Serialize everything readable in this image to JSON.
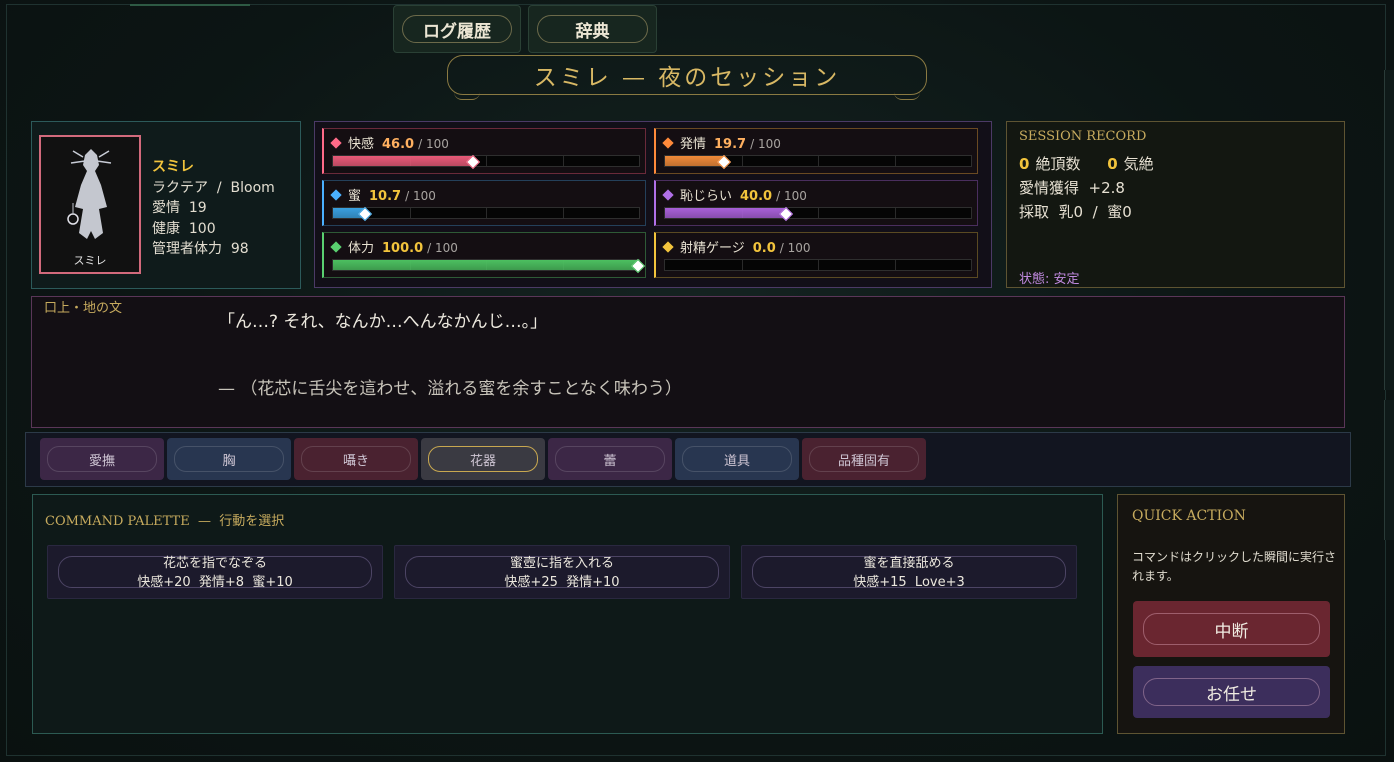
{
  "top_buttons": {
    "log": "ログ履歴",
    "dict": "辞典"
  },
  "title": "スミレ — 夜のセッション",
  "character": {
    "portrait_label": "スミレ",
    "name": "スミレ",
    "species_line": "ラクテア  /  Bloom",
    "affection": "愛情  19",
    "health": "健康  100",
    "manager_stamina": "管理者体力  98"
  },
  "stats": [
    {
      "label": "快感",
      "value": "46.0",
      "max": "/ 100",
      "fraction": 0.46,
      "color": "#e85a78",
      "diamond": "#ff6a88",
      "val_color": "#ffb060"
    },
    {
      "label": "発情",
      "value": "19.7",
      "max": "/ 100",
      "fraction": 0.197,
      "color": "#f08a3a",
      "diamond": "#ff8a3a",
      "val_color": "#ffb060"
    },
    {
      "label": "蜜",
      "value": "10.7",
      "max": "/ 100",
      "fraction": 0.107,
      "color": "#3aa0e0",
      "diamond": "#4ab0ff",
      "val_color": "#f2c43c"
    },
    {
      "label": "恥じらい",
      "value": "40.0",
      "max": "/ 100",
      "fraction": 0.4,
      "color": "#a860d8",
      "diamond": "#b070e8",
      "val_color": "#f2c43c"
    },
    {
      "label": "体力",
      "value": "100.0",
      "max": "/ 100",
      "fraction": 1.0,
      "color": "#4cc060",
      "diamond": "#5ad070",
      "val_color": "#f2c43c"
    },
    {
      "label": "射精ゲージ",
      "value": "0.0",
      "max": "/ 100",
      "fraction": 0.0,
      "color": "#e0b040",
      "diamond": "#f2c43c",
      "val_color": "#f2c43c"
    }
  ],
  "session": {
    "header": "SESSION RECORD",
    "climax_count": "0",
    "climax_label": "絶頂数",
    "faint_count": "0",
    "faint_label": "気絶",
    "affection_gain": "愛情獲得  +2.8",
    "harvest": "採取  乳0  /  蜜0",
    "state": "状態: 安定"
  },
  "dialogue": {
    "tag": "口上・地の文",
    "line1": "「ん…? それ、なんか…へんなかんじ…。」",
    "line2": "— （花芯に舌尖を這わせ、溢れる蜜を余すことなく味わう）"
  },
  "tabs": [
    {
      "label": "愛撫",
      "bg": "#3c2746",
      "active": false
    },
    {
      "label": "胸",
      "bg": "#283650",
      "active": false
    },
    {
      "label": "囁き",
      "bg": "#4a2230",
      "active": false
    },
    {
      "label": "花器",
      "bg": "#3a3a42",
      "active": true
    },
    {
      "label": "蕾",
      "bg": "#3c2746",
      "active": false
    },
    {
      "label": "道具",
      "bg": "#283650",
      "active": false
    },
    {
      "label": "品種固有",
      "bg": "#4a2230",
      "active": false
    }
  ],
  "palette": {
    "header": "COMMAND PALETTE  —  行動を選択",
    "commands": [
      {
        "name": "花芯を指でなぞる",
        "effect": "快感+20  発情+8  蜜+10"
      },
      {
        "name": "蜜壺に指を入れる",
        "effect": "快感+25  発情+10"
      },
      {
        "name": "蜜を直接舐める",
        "effect": "快感+15  Love+3"
      }
    ]
  },
  "quick": {
    "header": "QUICK ACTION",
    "desc": "コマンドはクリックした瞬間に実行されます。",
    "interrupt": "中断",
    "auto": "お任せ",
    "interrupt_color": "#6a2630",
    "auto_color": "#3c2e5c"
  }
}
